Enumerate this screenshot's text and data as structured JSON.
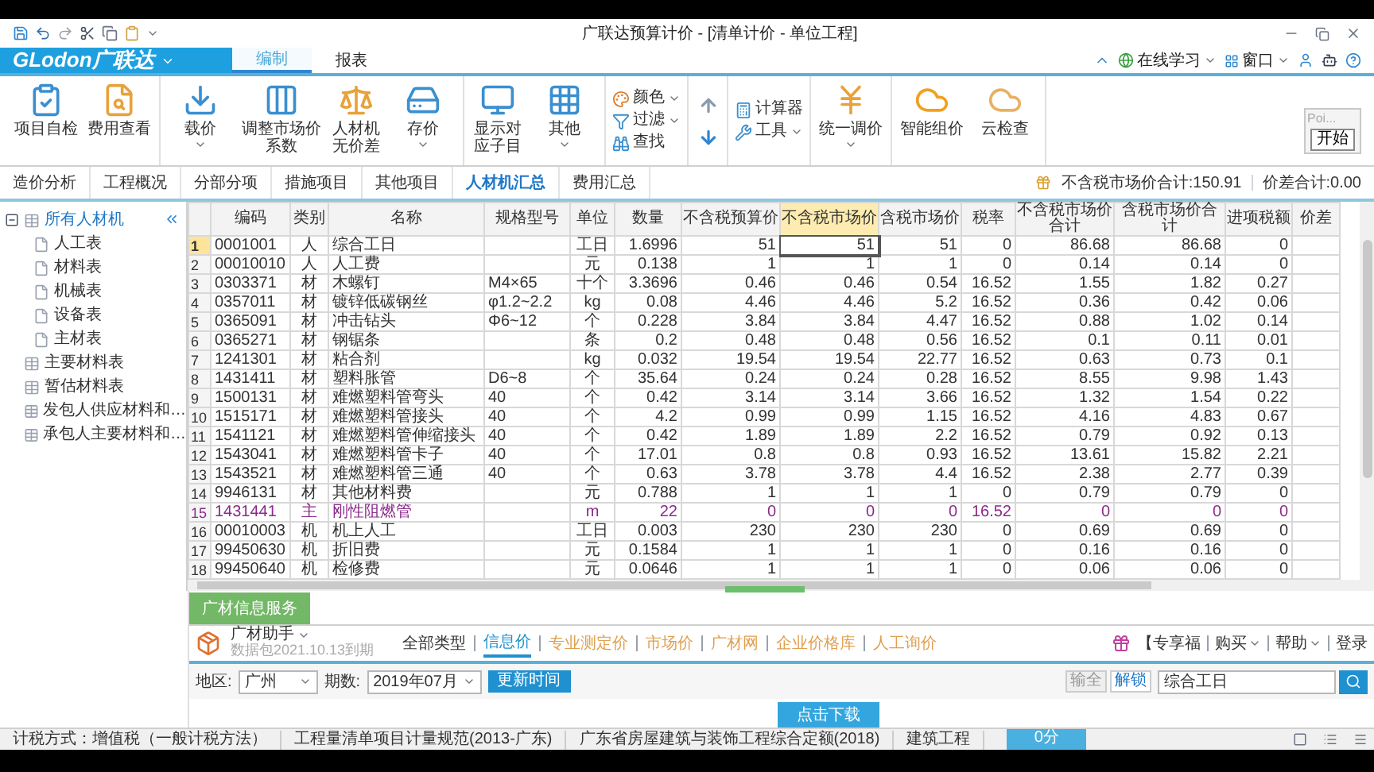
{
  "window": {
    "title": "广联达预算计价 - [清单计价 - 单位工程]"
  },
  "ribbon_tabs": {
    "logo": "GLodon广联达",
    "tabs": [
      {
        "label": "编制",
        "selected": true
      },
      {
        "label": "报表",
        "selected": false
      }
    ],
    "links": [
      {
        "label": "在线学习",
        "dropdown": true
      },
      {
        "label": "窗口",
        "dropdown": true
      }
    ]
  },
  "ribbon": {
    "groups": [
      {
        "kind": "row",
        "items": [
          {
            "kind": "large",
            "label": "项目自检",
            "dropdown": false
          },
          {
            "kind": "large",
            "label": "费用查看",
            "dropdown": false
          }
        ]
      },
      {
        "kind": "row",
        "items": [
          {
            "kind": "large",
            "label": "载价",
            "dropdown": true
          },
          {
            "kind": "large",
            "label": "调整市场价系数",
            "dropdown": false
          },
          {
            "kind": "large",
            "label": "人材机无价差",
            "dropdown": false
          },
          {
            "kind": "large",
            "label": "存价",
            "dropdown": true
          }
        ]
      },
      {
        "kind": "row",
        "items": [
          {
            "kind": "large",
            "label": "显示对应子目",
            "dropdown": false
          },
          {
            "kind": "large",
            "label": "其他",
            "dropdown": true
          }
        ]
      },
      {
        "kind": "column",
        "items": [
          {
            "kind": "small",
            "label": "颜色",
            "dropdown": true
          },
          {
            "kind": "small",
            "label": "过滤",
            "dropdown": true
          },
          {
            "kind": "small",
            "label": "查找",
            "dropdown": false
          }
        ]
      },
      {
        "kind": "column",
        "items": [
          {
            "kind": "up"
          },
          {
            "kind": "down"
          }
        ]
      },
      {
        "kind": "column",
        "items": [
          {
            "kind": "small",
            "label": "计算器",
            "dropdown": false
          },
          {
            "kind": "small",
            "label": "工具",
            "dropdown": true
          }
        ]
      },
      {
        "kind": "row",
        "items": [
          {
            "kind": "large",
            "label": "统一调价",
            "dropdown": true
          }
        ]
      },
      {
        "kind": "row",
        "items": [
          {
            "kind": "large",
            "label": "智能组价",
            "dropdown": false
          },
          {
            "kind": "large",
            "label": "云检查",
            "dropdown": false
          }
        ]
      }
    ]
  },
  "widget": {
    "label": "Poi...",
    "button": "开始"
  },
  "view_tabs": {
    "tabs": [
      {
        "label": "造价分析",
        "selected": false
      },
      {
        "label": "工程概况",
        "selected": false
      },
      {
        "label": "分部分项",
        "selected": false
      },
      {
        "label": "措施项目",
        "selected": false
      },
      {
        "label": "其他项目",
        "selected": false
      },
      {
        "label": "人材机汇总",
        "selected": true
      },
      {
        "label": "费用汇总",
        "selected": false
      }
    ],
    "totals": [
      "不含税市场价合计:150.91",
      "价差合计:0.00"
    ]
  },
  "sidebar": {
    "items": [
      {
        "label": "所有人材机",
        "expanded": true,
        "selected": true,
        "children": [
          {
            "label": "人工表",
            "selected": false
          },
          {
            "label": "材料表",
            "selected": false
          },
          {
            "label": "机械表",
            "selected": false
          },
          {
            "label": "设备表",
            "selected": false
          },
          {
            "label": "主材表",
            "selected": false
          }
        ]
      },
      {
        "label": "主要材料表",
        "selected": false
      },
      {
        "label": "暂估材料表",
        "selected": false
      },
      {
        "label": "发包人供应材料和…",
        "selected": false
      },
      {
        "label": "承包人主要材料和…",
        "selected": false
      }
    ]
  },
  "table": {
    "columns": [
      {
        "label": "编码",
        "selected": false
      },
      {
        "label": "类别",
        "selected": false
      },
      {
        "label": "名称",
        "selected": false
      },
      {
        "label": "规格型号",
        "selected": false
      },
      {
        "label": "单位",
        "selected": false
      },
      {
        "label": "数量",
        "selected": false
      },
      {
        "label": "不含税预算价",
        "selected": false
      },
      {
        "label": "不含税市场价",
        "selected": true
      },
      {
        "label": "含税市场价",
        "selected": false
      },
      {
        "label": "税率",
        "selected": false
      },
      {
        "label": "不含税市场价合计",
        "selected": false
      },
      {
        "label": "含税市场价合计",
        "selected": false
      },
      {
        "label": "进项税额",
        "selected": false
      },
      {
        "label": "价差",
        "selected": false
      }
    ],
    "rows": [
      {
        "num": "1",
        "selected": true,
        "highlighted": false,
        "cells": [
          "0001001",
          "人",
          "综合工日",
          "",
          "工日",
          "1.6996",
          "51",
          "51",
          "51",
          "0",
          "86.68",
          "86.68",
          "0",
          ""
        ]
      },
      {
        "num": "2",
        "selected": false,
        "highlighted": false,
        "cells": [
          "00010010",
          "人",
          "人工费",
          "",
          "元",
          "0.138",
          "1",
          "1",
          "1",
          "0",
          "0.14",
          "0.14",
          "0",
          ""
        ]
      },
      {
        "num": "3",
        "selected": false,
        "highlighted": false,
        "cells": [
          "0303371",
          "材",
          "木螺钉",
          "M4×65",
          "十个",
          "3.3696",
          "0.46",
          "0.46",
          "0.54",
          "16.52",
          "1.55",
          "1.82",
          "0.27",
          ""
        ]
      },
      {
        "num": "4",
        "selected": false,
        "highlighted": false,
        "cells": [
          "0357011",
          "材",
          "镀锌低碳钢丝",
          "φ1.2~2.2",
          "kg",
          "0.08",
          "4.46",
          "4.46",
          "5.2",
          "16.52",
          "0.36",
          "0.42",
          "0.06",
          ""
        ]
      },
      {
        "num": "5",
        "selected": false,
        "highlighted": false,
        "cells": [
          "0365091",
          "材",
          "冲击钻头",
          "Φ6~12",
          "个",
          "0.228",
          "3.84",
          "3.84",
          "4.47",
          "16.52",
          "0.88",
          "1.02",
          "0.14",
          ""
        ]
      },
      {
        "num": "6",
        "selected": false,
        "highlighted": false,
        "cells": [
          "0365271",
          "材",
          "钢锯条",
          "",
          "条",
          "0.2",
          "0.48",
          "0.48",
          "0.56",
          "16.52",
          "0.1",
          "0.11",
          "0.01",
          ""
        ]
      },
      {
        "num": "7",
        "selected": false,
        "highlighted": false,
        "cells": [
          "1241301",
          "材",
          "粘合剂",
          "",
          "kg",
          "0.032",
          "19.54",
          "19.54",
          "22.77",
          "16.52",
          "0.63",
          "0.73",
          "0.1",
          ""
        ]
      },
      {
        "num": "8",
        "selected": false,
        "highlighted": false,
        "cells": [
          "1431411",
          "材",
          "塑料胀管",
          "D6~8",
          "个",
          "35.64",
          "0.24",
          "0.24",
          "0.28",
          "16.52",
          "8.55",
          "9.98",
          "1.43",
          ""
        ]
      },
      {
        "num": "9",
        "selected": false,
        "highlighted": false,
        "cells": [
          "1500131",
          "材",
          "难燃塑料管弯头",
          "40",
          "个",
          "0.42",
          "3.14",
          "3.14",
          "3.66",
          "16.52",
          "1.32",
          "1.54",
          "0.22",
          ""
        ]
      },
      {
        "num": "10",
        "selected": false,
        "highlighted": false,
        "cells": [
          "1515171",
          "材",
          "难燃塑料管接头",
          "40",
          "个",
          "4.2",
          "0.99",
          "0.99",
          "1.15",
          "16.52",
          "4.16",
          "4.83",
          "0.67",
          ""
        ]
      },
      {
        "num": "11",
        "selected": false,
        "highlighted": false,
        "cells": [
          "1541121",
          "材",
          "难燃塑料管伸缩接头",
          "40",
          "个",
          "0.42",
          "1.89",
          "1.89",
          "2.2",
          "16.52",
          "0.79",
          "0.92",
          "0.13",
          ""
        ]
      },
      {
        "num": "12",
        "selected": false,
        "highlighted": false,
        "cells": [
          "1543041",
          "材",
          "难燃塑料管卡子",
          "40",
          "个",
          "17.01",
          "0.8",
          "0.8",
          "0.93",
          "16.52",
          "13.61",
          "15.82",
          "2.21",
          ""
        ]
      },
      {
        "num": "13",
        "selected": false,
        "highlighted": false,
        "cells": [
          "1543521",
          "材",
          "难燃塑料管三通",
          "40",
          "个",
          "0.63",
          "3.78",
          "3.78",
          "4.4",
          "16.52",
          "2.38",
          "2.77",
          "0.39",
          ""
        ]
      },
      {
        "num": "14",
        "selected": false,
        "highlighted": false,
        "cells": [
          "9946131",
          "材",
          "其他材料费",
          "",
          "元",
          "0.788",
          "1",
          "1",
          "1",
          "0",
          "0.79",
          "0.79",
          "0",
          ""
        ]
      },
      {
        "num": "15",
        "selected": false,
        "highlighted": true,
        "cells": [
          "1431441",
          "主",
          "刚性阻燃管",
          "",
          "m",
          "22",
          "0",
          "0",
          "0",
          "16.52",
          "0",
          "0",
          "0",
          ""
        ]
      },
      {
        "num": "16",
        "selected": false,
        "highlighted": false,
        "cells": [
          "00010003",
          "机",
          "机上人工",
          "",
          "工日",
          "0.003",
          "230",
          "230",
          "230",
          "0",
          "0.69",
          "0.69",
          "0",
          ""
        ]
      },
      {
        "num": "17",
        "selected": false,
        "highlighted": false,
        "cells": [
          "99450630",
          "机",
          "折旧费",
          "",
          "元",
          "0.1584",
          "1",
          "1",
          "1",
          "0",
          "0.16",
          "0.16",
          "0",
          ""
        ]
      },
      {
        "num": "18",
        "selected": false,
        "highlighted": false,
        "cells": [
          "99450640",
          "机",
          "检修费",
          "",
          "元",
          "0.0646",
          "1",
          "1",
          "1",
          "0",
          "0.06",
          "0.06",
          "0",
          ""
        ]
      }
    ]
  },
  "info_panel": {
    "title": "广材信息服务",
    "assistant": {
      "label": "广材助手",
      "note": "数据包2021.10.13到期"
    },
    "tabs": [
      {
        "label": "全部类型",
        "selected": false
      },
      {
        "label": "信息价",
        "selected": true
      },
      {
        "label": "专业测定价",
        "selected": false
      },
      {
        "label": "市场价",
        "selected": false
      },
      {
        "label": "广材网",
        "selected": false
      },
      {
        "label": "企业价格库",
        "selected": false
      },
      {
        "label": "人工询价",
        "selected": false
      }
    ],
    "promo": "【专享福",
    "links": [
      {
        "label": "购买",
        "dropdown": true
      },
      {
        "label": "帮助",
        "dropdown": true
      },
      {
        "label": "登录",
        "dropdown": false
      }
    ],
    "filters": [
      {
        "label": "地区:",
        "value": "广州"
      },
      {
        "label": "期数:",
        "value": "2019年07月"
      }
    ],
    "update_button": "更新时间",
    "buttons": [
      "输全",
      "解锁"
    ],
    "search": {
      "value": "综合工日"
    },
    "download_button": "点击下载"
  },
  "status_bar": {
    "items": [
      "计税方式：增值税（一般计税方法）",
      "工程量清单项目计量规范(2013-广东)",
      "广东省房屋建筑与装饰工程综合定额(2018)",
      "建筑工程"
    ],
    "score": "0分"
  }
}
